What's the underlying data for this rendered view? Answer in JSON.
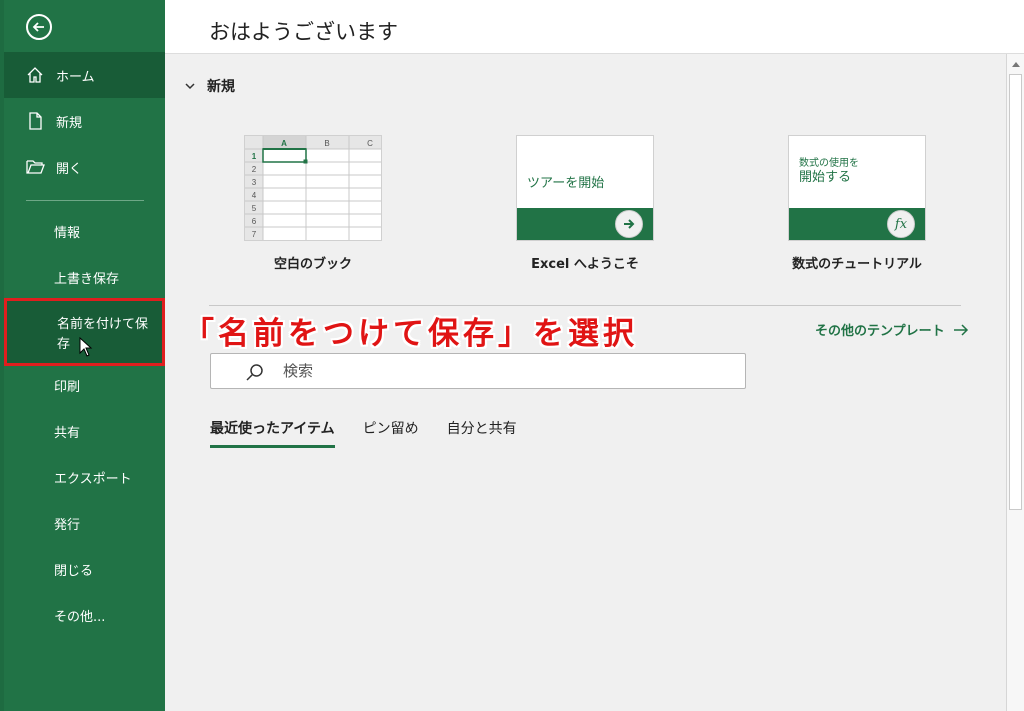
{
  "greeting": "おはようございます",
  "sidebar": {
    "items": [
      {
        "id": "home",
        "label": "ホーム",
        "icon": "home-icon"
      },
      {
        "id": "new",
        "label": "新規",
        "icon": "new-document-icon"
      },
      {
        "id": "open",
        "label": "開く",
        "icon": "folder-open-icon"
      },
      {
        "id": "info",
        "label": "情報"
      },
      {
        "id": "save",
        "label": "上書き保存"
      },
      {
        "id": "saveas",
        "label": "名前を付けて保存"
      },
      {
        "id": "print",
        "label": "印刷"
      },
      {
        "id": "share",
        "label": "共有"
      },
      {
        "id": "export",
        "label": "エクスポート"
      },
      {
        "id": "publish",
        "label": "発行"
      },
      {
        "id": "close",
        "label": "閉じる"
      },
      {
        "id": "more",
        "label": "その他..."
      }
    ]
  },
  "new_section": {
    "label": "新規",
    "templates": [
      {
        "name": "空白のブック"
      },
      {
        "name": "Excel へようこそ",
        "thumb_text": "ツアーを開始"
      },
      {
        "name": "数式のチュートリアル",
        "thumb_line1": "数式の使用を",
        "thumb_line2": "開始する",
        "thumb_icon_text": "fx"
      }
    ],
    "sheet": {
      "columns": [
        "A",
        "B",
        "C"
      ],
      "rows": [
        "1",
        "2",
        "3",
        "4",
        "5",
        "6",
        "7"
      ]
    },
    "more_templates": "その他のテンプレート"
  },
  "annotation": "「名前をつけて保存」を選択",
  "search": {
    "placeholder": "検索"
  },
  "tabs": [
    "最近使ったアイテム",
    "ピン留め",
    "自分と共有"
  ],
  "colors": {
    "accent": "#217346",
    "annotation": "#e01414"
  }
}
